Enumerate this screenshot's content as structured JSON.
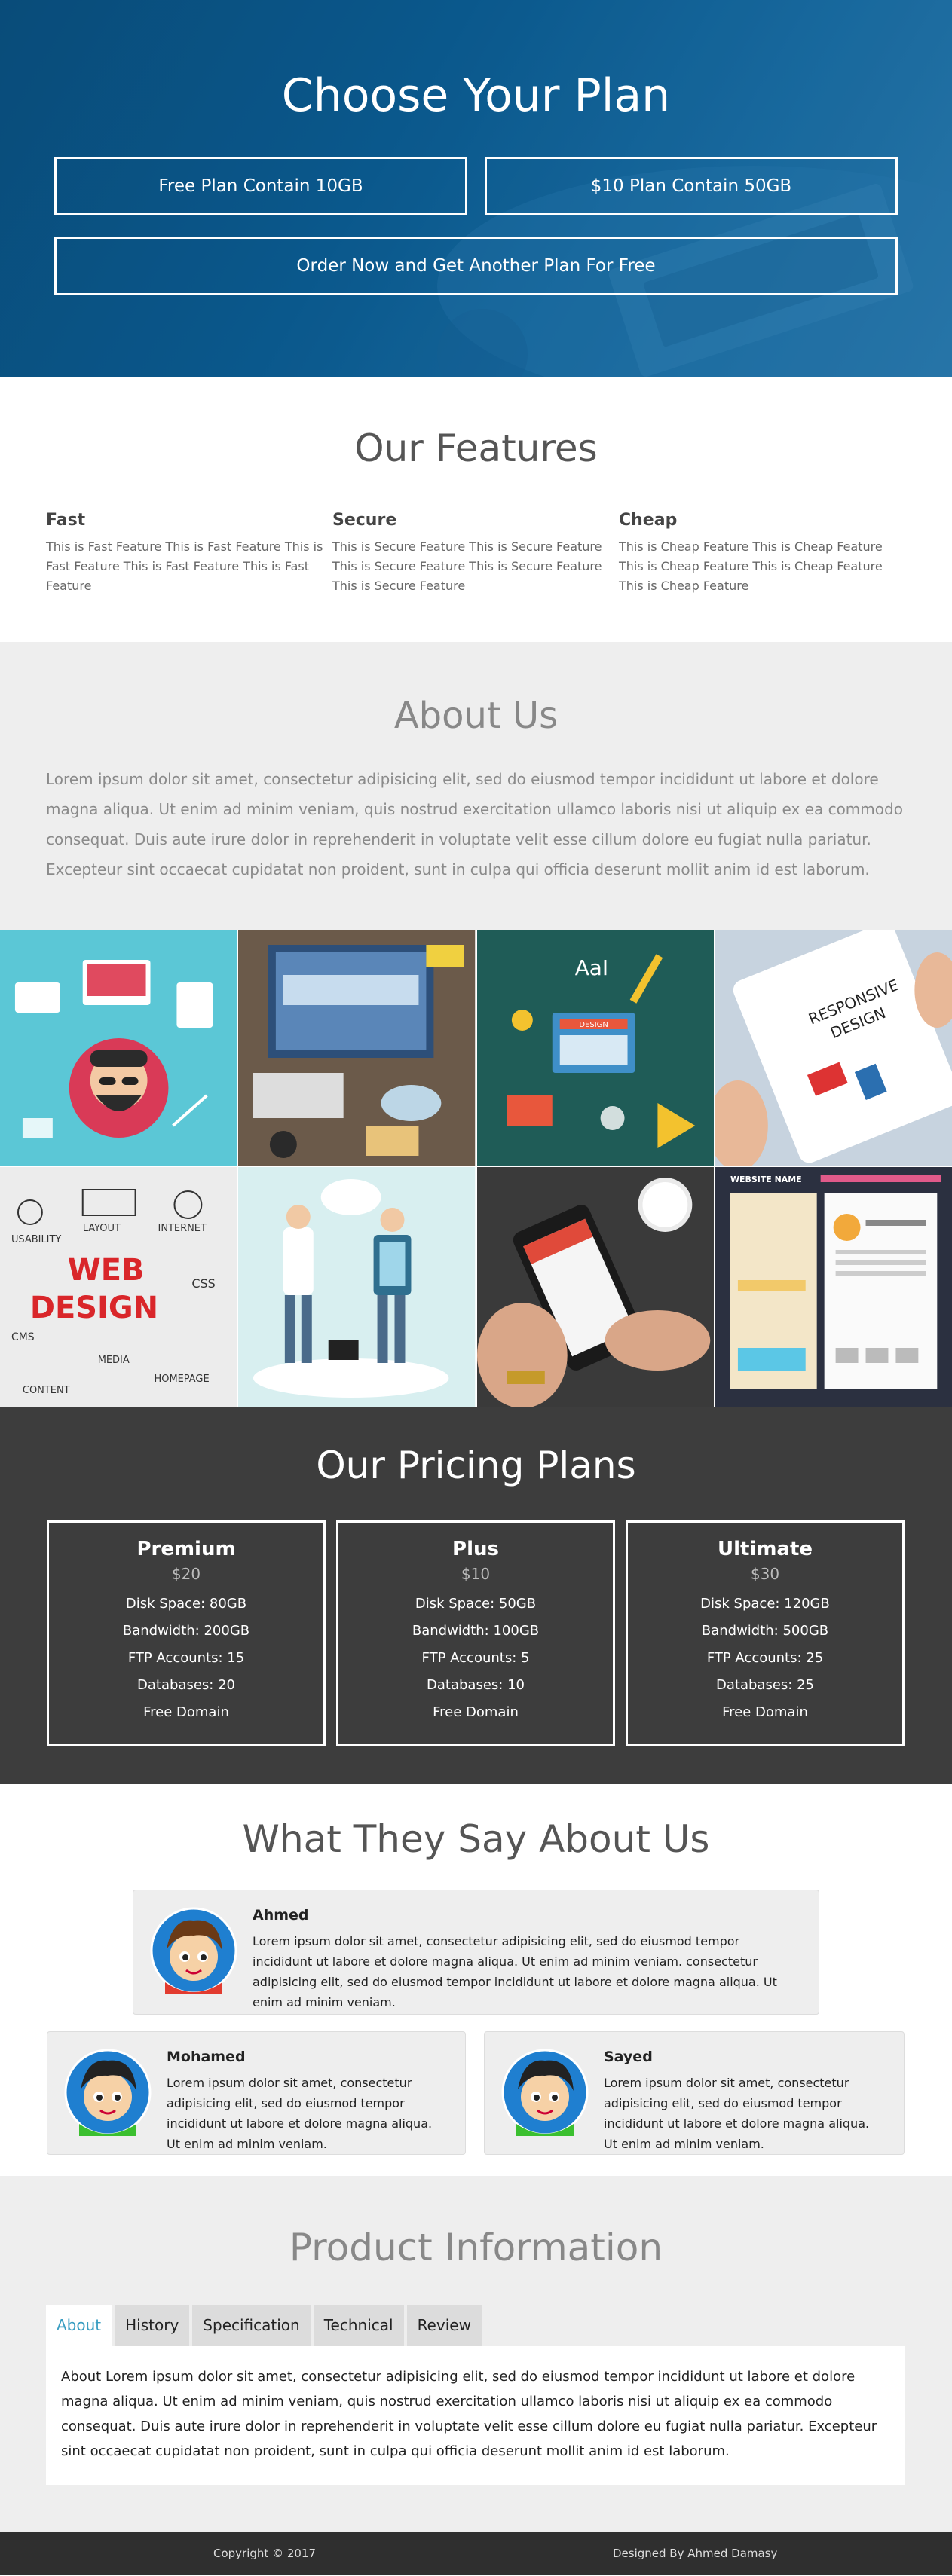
{
  "hero": {
    "title": "Choose Your Plan",
    "buttons": [
      "Free Plan Contain 10GB",
      "$10 Plan Contain 50GB",
      "Order Now and Get Another Plan For Free"
    ]
  },
  "features": {
    "title": "Our Features",
    "items": [
      {
        "title": "Fast",
        "text": "This is Fast Feature This is Fast Feature This is Fast Feature This is Fast Feature This is Fast Feature"
      },
      {
        "title": "Secure",
        "text": "This is Secure Feature This is Secure Feature This is Secure Feature This is Secure Feature This is Secure Feature"
      },
      {
        "title": "Cheap",
        "text": "This is Cheap Feature This is Cheap Feature This is Cheap Feature This is Cheap Feature This is Cheap Feature"
      }
    ]
  },
  "about": {
    "title": "About Us",
    "text": "Lorem ipsum dolor sit amet, consectetur adipisicing elit, sed do eiusmod tempor incididunt ut labore et dolore magna aliqua. Ut enim ad minim veniam, quis nostrud exercitation ullamco laboris nisi ut aliquip ex ea commodo consequat. Duis aute irure dolor in reprehenderit in voluptate velit esse cillum dolore eu fugiat nulla pariatur. Excepteur sint occaecat cupidatat non proident, sunt in culpa qui officia deserunt mollit anim id est laborum."
  },
  "gallery": {
    "labels": {
      "design": "DESIGN",
      "aai": "AaI",
      "responsive": "RESPONSIVE",
      "design2": "DESIGN",
      "web": "WEB",
      "web_design": "DESIGN",
      "usability": "USABILITY",
      "layout": "LAYOUT",
      "internet": "INTERNET",
      "css": "CSS",
      "cms": "CMS",
      "media": "MEDIA",
      "content": "CONTENT",
      "homepage": "HOMEPAGE",
      "website_name": "WEBSITE NAME"
    }
  },
  "pricing": {
    "title": "Our Pricing Plans",
    "plans": [
      {
        "name": "Premium",
        "price": "$20",
        "features": [
          "Disk Space: 80GB",
          "Bandwidth: 200GB",
          "FTP Accounts: 15",
          "Databases: 20",
          "Free Domain"
        ]
      },
      {
        "name": "Plus",
        "price": "$10",
        "features": [
          "Disk Space: 50GB",
          "Bandwidth: 100GB",
          "FTP Accounts: 5",
          "Databases: 10",
          "Free Domain"
        ]
      },
      {
        "name": "Ultimate",
        "price": "$30",
        "features": [
          "Disk Space: 120GB",
          "Bandwidth: 500GB",
          "FTP Accounts: 25",
          "Databases: 25",
          "Free Domain"
        ]
      }
    ]
  },
  "testimonials": {
    "title": "What They Say About Us",
    "items": [
      {
        "name": "Ahmed",
        "text": "Lorem ipsum dolor sit amet, consectetur adipisicing elit, sed do eiusmod tempor incididunt ut labore et dolore magna aliqua. Ut enim ad minim veniam. consectetur adipisicing elit, sed do eiusmod tempor incididunt ut labore et dolore magna aliqua. Ut enim ad minim veniam."
      },
      {
        "name": "Mohamed",
        "text": "Lorem ipsum dolor sit amet, consectetur adipisicing elit, sed do eiusmod tempor incididunt ut labore et dolore magna aliqua. Ut enim ad minim veniam."
      },
      {
        "name": "Sayed",
        "text": "Lorem ipsum dolor sit amet, consectetur adipisicing elit, sed do eiusmod tempor incididunt ut labore et dolore magna aliqua. Ut enim ad minim veniam."
      }
    ]
  },
  "product": {
    "title": "Product Information",
    "tabs": [
      "About",
      "History",
      "Specification",
      "Technical",
      "Review"
    ],
    "active_tab": "About",
    "panel_text": "About Lorem ipsum dolor sit amet, consectetur adipisicing elit, sed do eiusmod tempor incididunt ut labore et dolore magna aliqua. Ut enim ad minim veniam, quis nostrud exercitation ullamco laboris nisi ut aliquip ex ea commodo consequat. Duis aute irure dolor in reprehenderit in voluptate velit esse cillum dolore eu fugiat nulla pariatur. Excepteur sint occaecat cupidatat non proident, sunt in culpa qui officia deserunt mollit anim id est laborum."
  },
  "footer": {
    "copyright": "Copyright © 2017",
    "credit": "Designed By Ahmed Damasy"
  },
  "colors": {
    "hero_blue": "#0b5d93",
    "pricing_bg": "#3d3d3d",
    "section_grey": "#eeeeee",
    "tab_active": "#3a9ec2",
    "footer_bg": "#2f2f2f"
  }
}
